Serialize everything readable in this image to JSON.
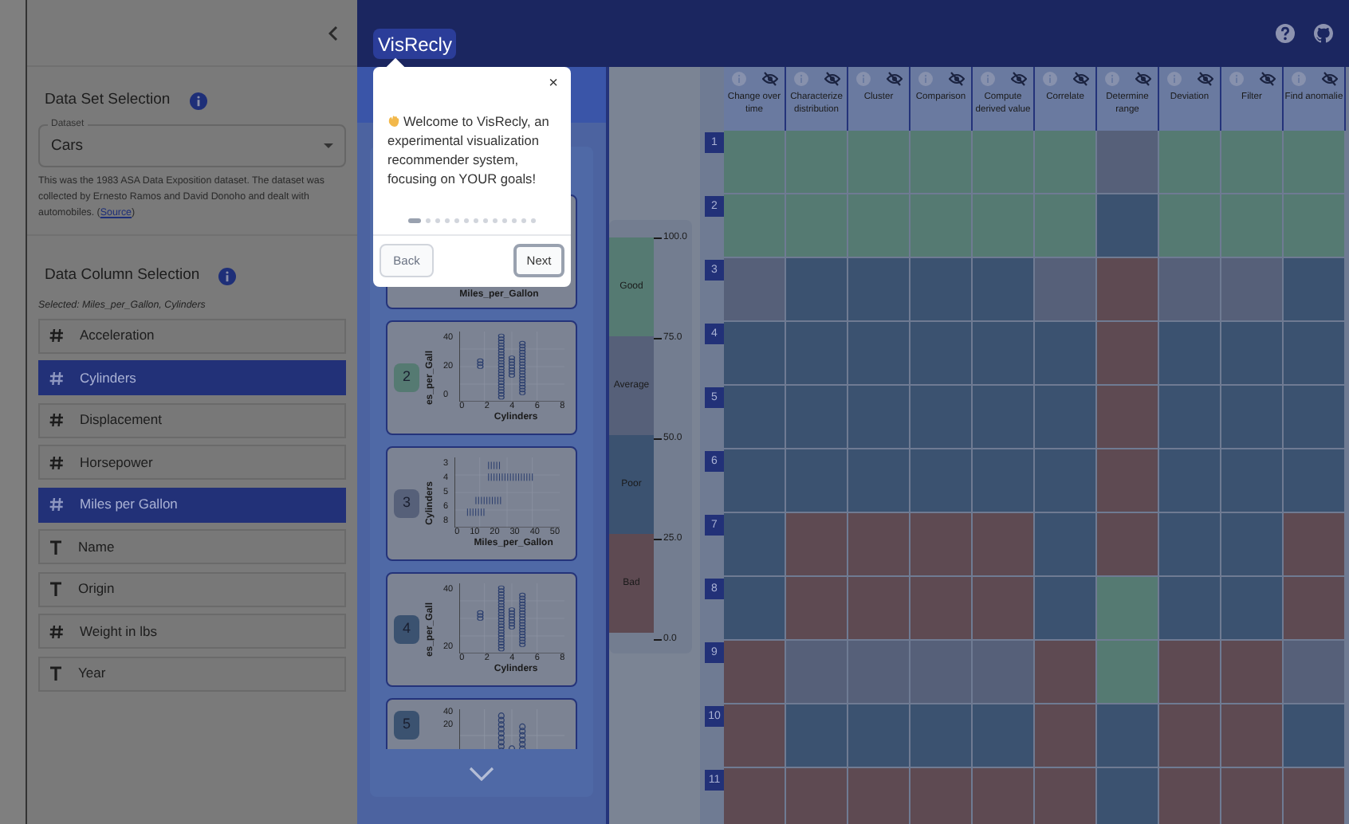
{
  "sidebar": {
    "dataset_section": {
      "title": "Data Set Selection",
      "field_label": "Dataset",
      "value": "Cars",
      "description": "This was the 1983 ASA Data Exposition dataset. The dataset was collected by Ernesto Ramos and David Donoho and dealt with automobiles. (",
      "link": "Source",
      "description_end": ")"
    },
    "column_section": {
      "title": "Data Column Selection",
      "selected_text": "Selected: Miles_per_Gallon, Cylinders",
      "columns": [
        {
          "kind": "number",
          "label": "Acceleration",
          "selected": false
        },
        {
          "kind": "number",
          "label": "Cylinders",
          "selected": true
        },
        {
          "kind": "number",
          "label": "Displacement",
          "selected": false
        },
        {
          "kind": "number",
          "label": "Horsepower",
          "selected": false
        },
        {
          "kind": "number",
          "label": "Miles per Gallon",
          "selected": true
        },
        {
          "kind": "text",
          "label": "Name",
          "selected": false
        },
        {
          "kind": "text",
          "label": "Origin",
          "selected": false
        },
        {
          "kind": "number",
          "label": "Weight in lbs",
          "selected": false
        },
        {
          "kind": "text",
          "label": "Year",
          "selected": false
        }
      ]
    }
  },
  "app_title": "VisRecly",
  "popover": {
    "text": "Welcome to VisRecly, an experimental visualization recommender system, focusing on YOUR goals!",
    "steps": [
      {
        "selected": true
      },
      {
        "selected": false
      },
      {
        "selected": false
      },
      {
        "selected": false
      },
      {
        "selected": false
      },
      {
        "selected": false
      },
      {
        "selected": false
      },
      {
        "selected": false
      },
      {
        "selected": false
      },
      {
        "selected": false
      },
      {
        "selected": false
      },
      {
        "selected": false
      },
      {
        "selected": false
      }
    ],
    "back": "Back",
    "next": "Next",
    "back_disabled": true,
    "close": "×"
  },
  "thumbnails": [
    {
      "kind": "covered",
      "x_label": "Miles_per_Gallon"
    },
    {
      "number": "2",
      "color": "#557a72",
      "kind": "scatter",
      "y_label": "es_per_Gall",
      "y_ticks": [
        "40",
        "20",
        "0"
      ],
      "x_ticks": [
        "0",
        "2",
        "4",
        "6",
        "8"
      ],
      "x_label": "Cylinders"
    },
    {
      "number": "3",
      "color": "#566079",
      "kind": "strip",
      "y_label": "Cylinders",
      "y_ticks": [
        "3",
        "4",
        "5",
        "6",
        "8"
      ],
      "x_ticks": [
        "0",
        "10",
        "20",
        "30",
        "40",
        "50"
      ],
      "x_label": "Miles_per_Gallon"
    },
    {
      "number": "4",
      "color": "#3b5270",
      "kind": "scatter",
      "y_label": "es_per_Gall",
      "y_ticks": [
        "40",
        "20"
      ],
      "x_ticks": [
        "0",
        "2",
        "4",
        "6",
        "8"
      ],
      "x_label": "Cylinders"
    },
    {
      "number": "5",
      "color": "#3b5270",
      "kind": "scatter_cut",
      "y_ticks": [
        "40",
        "20"
      ]
    }
  ],
  "legend": [
    {
      "color": "#557a72",
      "label": "Good"
    },
    {
      "color": "#566079",
      "label": "Average"
    },
    {
      "color": "#3b5270",
      "label": "Poor"
    },
    {
      "color": "#5e4a52",
      "label": "Bad"
    }
  ],
  "legend_ticks": [
    "100.0",
    "75.0",
    "50.0",
    "25.0",
    "0.0"
  ],
  "heatmap": {
    "columns": [
      "Change over time",
      "Characterize distribution",
      "Cluster",
      "Comparison",
      "Compute derived value",
      "Correlate",
      "Determine range",
      "Deviation",
      "Filter",
      "Find anomalie"
    ],
    "rows": [
      {
        "label": "1",
        "cells": [
          {
            "color": "#557a72"
          },
          {
            "color": "#557a72"
          },
          {
            "color": "#557a72"
          },
          {
            "color": "#557a72"
          },
          {
            "color": "#557a72"
          },
          {
            "color": "#557a72"
          },
          {
            "color": "#566079"
          },
          {
            "color": "#557a72"
          },
          {
            "color": "#557a72"
          },
          {
            "color": "#557a72"
          }
        ]
      },
      {
        "label": "2",
        "cells": [
          {
            "color": "#557a72"
          },
          {
            "color": "#557a72"
          },
          {
            "color": "#557a72"
          },
          {
            "color": "#557a72"
          },
          {
            "color": "#557a72"
          },
          {
            "color": "#557a72"
          },
          {
            "color": "#3b5270"
          },
          {
            "color": "#557a72"
          },
          {
            "color": "#557a72"
          },
          {
            "color": "#557a72"
          }
        ]
      },
      {
        "label": "3",
        "cells": [
          {
            "color": "#566079"
          },
          {
            "color": "#3b5270"
          },
          {
            "color": "#3b5270"
          },
          {
            "color": "#3b5270"
          },
          {
            "color": "#3b5270"
          },
          {
            "color": "#566079"
          },
          {
            "color": "#5e4a52"
          },
          {
            "color": "#566079"
          },
          {
            "color": "#566079"
          },
          {
            "color": "#3b5270"
          }
        ]
      },
      {
        "label": "4",
        "cells": [
          {
            "color": "#3b5270"
          },
          {
            "color": "#3b5270"
          },
          {
            "color": "#3b5270"
          },
          {
            "color": "#3b5270"
          },
          {
            "color": "#3b5270"
          },
          {
            "color": "#3b5270"
          },
          {
            "color": "#5e4a52"
          },
          {
            "color": "#3b5270"
          },
          {
            "color": "#3b5270"
          },
          {
            "color": "#3b5270"
          }
        ]
      },
      {
        "label": "5",
        "cells": [
          {
            "color": "#3b5270"
          },
          {
            "color": "#3b5270"
          },
          {
            "color": "#3b5270"
          },
          {
            "color": "#3b5270"
          },
          {
            "color": "#3b5270"
          },
          {
            "color": "#3b5270"
          },
          {
            "color": "#5e4a52"
          },
          {
            "color": "#3b5270"
          },
          {
            "color": "#3b5270"
          },
          {
            "color": "#3b5270"
          }
        ]
      },
      {
        "label": "6",
        "cells": [
          {
            "color": "#3b5270"
          },
          {
            "color": "#3b5270"
          },
          {
            "color": "#3b5270"
          },
          {
            "color": "#3b5270"
          },
          {
            "color": "#3b5270"
          },
          {
            "color": "#3b5270"
          },
          {
            "color": "#5e4a52"
          },
          {
            "color": "#3b5270"
          },
          {
            "color": "#3b5270"
          },
          {
            "color": "#3b5270"
          }
        ]
      },
      {
        "label": "7",
        "cells": [
          {
            "color": "#3b5270"
          },
          {
            "color": "#5e4a52"
          },
          {
            "color": "#5e4a52"
          },
          {
            "color": "#5e4a52"
          },
          {
            "color": "#5e4a52"
          },
          {
            "color": "#3b5270"
          },
          {
            "color": "#5e4a52"
          },
          {
            "color": "#3b5270"
          },
          {
            "color": "#3b5270"
          },
          {
            "color": "#5e4a52"
          }
        ]
      },
      {
        "label": "8",
        "cells": [
          {
            "color": "#3b5270"
          },
          {
            "color": "#5e4a52"
          },
          {
            "color": "#5e4a52"
          },
          {
            "color": "#5e4a52"
          },
          {
            "color": "#5e4a52"
          },
          {
            "color": "#3b5270"
          },
          {
            "color": "#557a72"
          },
          {
            "color": "#3b5270"
          },
          {
            "color": "#3b5270"
          },
          {
            "color": "#5e4a52"
          }
        ]
      },
      {
        "label": "9",
        "cells": [
          {
            "color": "#5e4a52"
          },
          {
            "color": "#566079"
          },
          {
            "color": "#566079"
          },
          {
            "color": "#566079"
          },
          {
            "color": "#566079"
          },
          {
            "color": "#5e4a52"
          },
          {
            "color": "#557a72"
          },
          {
            "color": "#5e4a52"
          },
          {
            "color": "#5e4a52"
          },
          {
            "color": "#566079"
          }
        ]
      },
      {
        "label": "10",
        "cells": [
          {
            "color": "#5e4a52"
          },
          {
            "color": "#3b5270"
          },
          {
            "color": "#3b5270"
          },
          {
            "color": "#3b5270"
          },
          {
            "color": "#3b5270"
          },
          {
            "color": "#5e4a52"
          },
          {
            "color": "#3b5270"
          },
          {
            "color": "#5e4a52"
          },
          {
            "color": "#5e4a52"
          },
          {
            "color": "#3b5270"
          }
        ]
      },
      {
        "label": "11",
        "cells": [
          {
            "color": "#5e4a52"
          },
          {
            "color": "#5e4a52"
          },
          {
            "color": "#5e4a52"
          },
          {
            "color": "#5e4a52"
          },
          {
            "color": "#5e4a52"
          },
          {
            "color": "#5e4a52"
          },
          {
            "color": "#3b5270"
          },
          {
            "color": "#5e4a52"
          },
          {
            "color": "#5e4a52"
          },
          {
            "color": "#5e4a52"
          }
        ]
      }
    ]
  }
}
